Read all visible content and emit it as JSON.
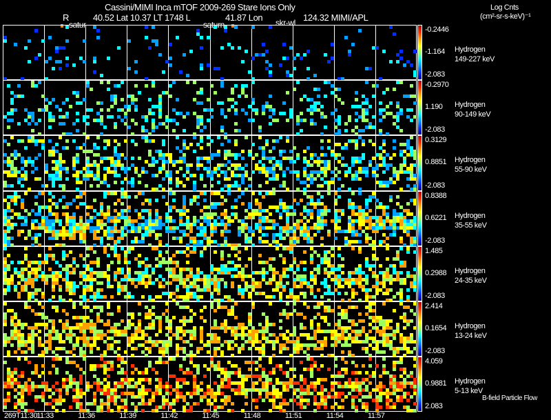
{
  "header": {
    "title": "Cassini/MIMI Inca mTOF  2009-269   Stare   Ions Only",
    "r_label": "R",
    "position_info": "40.52 Lat 10.37 LT 1748 L",
    "lon_info": "41.87 Lon",
    "mimi_info": "124.32  MIMI/APL",
    "markers": [
      "satur",
      "saturn",
      "skr-wl"
    ],
    "units_line1": "Log Cnts",
    "units_line2": "(cm²-sr-s-keV)⁻¹"
  },
  "chart_data": {
    "type": "heatmap",
    "x_ticks": [
      "269T11:30",
      "11:33",
      "11:36",
      "11:39",
      "11:42",
      "11:45",
      "11:48",
      "11:51",
      "11:54",
      "11:57"
    ],
    "colorscale": [
      "#0000a0",
      "#0030ff",
      "#00a0ff",
      "#00ffff",
      "#a0ff60",
      "#ffff00",
      "#ffa000",
      "#ff3000",
      "#c00000"
    ],
    "panels": [
      {
        "species": "Hydrogen",
        "energy": "149-227 keV",
        "cmax": "-0.2446",
        "cmid": "-1.164",
        "cmin": "-2.083"
      },
      {
        "species": "Hydrogen",
        "energy": "90-149 keV",
        "cmax": "-0.2970",
        "cmid": "1.190",
        "cmin": "-2.083"
      },
      {
        "species": "Hydrogen",
        "energy": "55-90 keV",
        "cmax": "0.3129",
        "cmid": "0.8851",
        "cmin": "-2.083"
      },
      {
        "species": "Hydrogen",
        "energy": "35-55 keV",
        "cmax": "0.8388",
        "cmid": "0.6221",
        "cmin": "-2.083"
      },
      {
        "species": "Hydrogen",
        "energy": "24-35 keV",
        "cmax": "1.485",
        "cmid": "0.2988",
        "cmin": "-2.083"
      },
      {
        "species": "Hydrogen",
        "energy": "13-24 keV",
        "cmax": "2.414",
        "cmid": "0.1654",
        "cmin": "-2.083"
      },
      {
        "species": "Hydrogen",
        "energy": "5-13 keV",
        "cmax": "4.059",
        "cmid": "0.9881",
        "cmin": "2.083"
      }
    ]
  },
  "footer": {
    "legend": "B-field Particle Flow"
  }
}
